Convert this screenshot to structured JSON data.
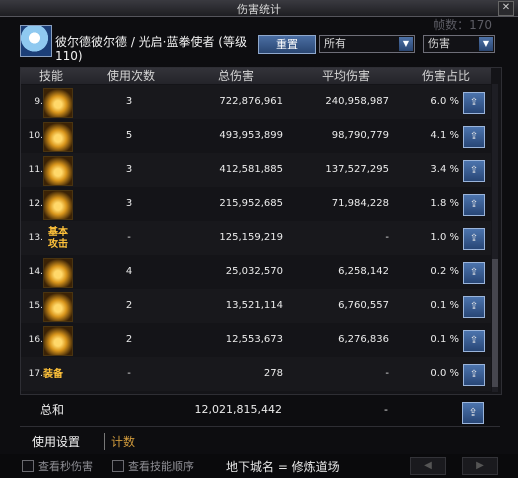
{
  "window": {
    "title": "伤害统计",
    "frame_count": "帧数：170"
  },
  "header": {
    "char_name": "彼尔德彼尔德 / 光启·蓝拳使者 (等级110)",
    "reset_label": "重置",
    "filter1": "所有",
    "filter2": "伤害"
  },
  "table": {
    "columns": [
      "技能",
      "使用次数",
      "总伤害",
      "平均伤害",
      "伤害占比"
    ],
    "rows": [
      {
        "idx": "9.",
        "icon": "golden-spin-skill-icon",
        "icon_text": "",
        "uses": "3",
        "total": "722,876,961",
        "avg": "240,958,987",
        "pct": "6.0 %"
      },
      {
        "idx": "10.",
        "icon": "golden-claw-skill-icon",
        "icon_text": "",
        "uses": "5",
        "total": "493,953,899",
        "avg": "98,790,779",
        "pct": "4.1 %"
      },
      {
        "idx": "11.",
        "icon": "golden-streak-skill-icon",
        "icon_text": "",
        "uses": "3",
        "total": "412,581,885",
        "avg": "137,527,295",
        "pct": "3.4 %"
      },
      {
        "idx": "12.",
        "icon": "golden-flame-skill-icon",
        "icon_text": "",
        "uses": "3",
        "total": "215,952,685",
        "avg": "71,984,228",
        "pct": "1.8 %"
      },
      {
        "idx": "13.",
        "icon": "basic-attack-icon",
        "icon_text": "基本\n攻击",
        "uses": "-",
        "total": "125,159,219",
        "avg": "-",
        "pct": "1.0 %"
      },
      {
        "idx": "14.",
        "icon": "golden-dash-skill-icon",
        "icon_text": "",
        "uses": "4",
        "total": "25,032,570",
        "avg": "6,258,142",
        "pct": "0.2 %"
      },
      {
        "idx": "15.",
        "icon": "golden-fist-skill-icon",
        "icon_text": "",
        "uses": "2",
        "total": "13,521,114",
        "avg": "6,760,557",
        "pct": "0.1 %"
      },
      {
        "idx": "16.",
        "icon": "golden-burst-skill-icon",
        "icon_text": "",
        "uses": "2",
        "total": "12,553,673",
        "avg": "6,276,836",
        "pct": "0.1 %"
      },
      {
        "idx": "17.",
        "icon": "equipment-icon",
        "icon_text": "装备",
        "uses": "-",
        "total": "278",
        "avg": "-",
        "pct": "0.0 %"
      }
    ],
    "total": {
      "label": "总和",
      "total": "12,021,815,442",
      "avg": "-"
    }
  },
  "tabs": [
    "使用设置",
    "计数"
  ],
  "footer": {
    "check_dps": "查看秒伤害",
    "check_order": "查看技能顺序",
    "dungeon": "地下城名 = 修炼道场"
  },
  "colors": {
    "accent_blue": "#3a5f96",
    "gold": "#ffc23a",
    "tab_gold": "#d09a3c"
  }
}
